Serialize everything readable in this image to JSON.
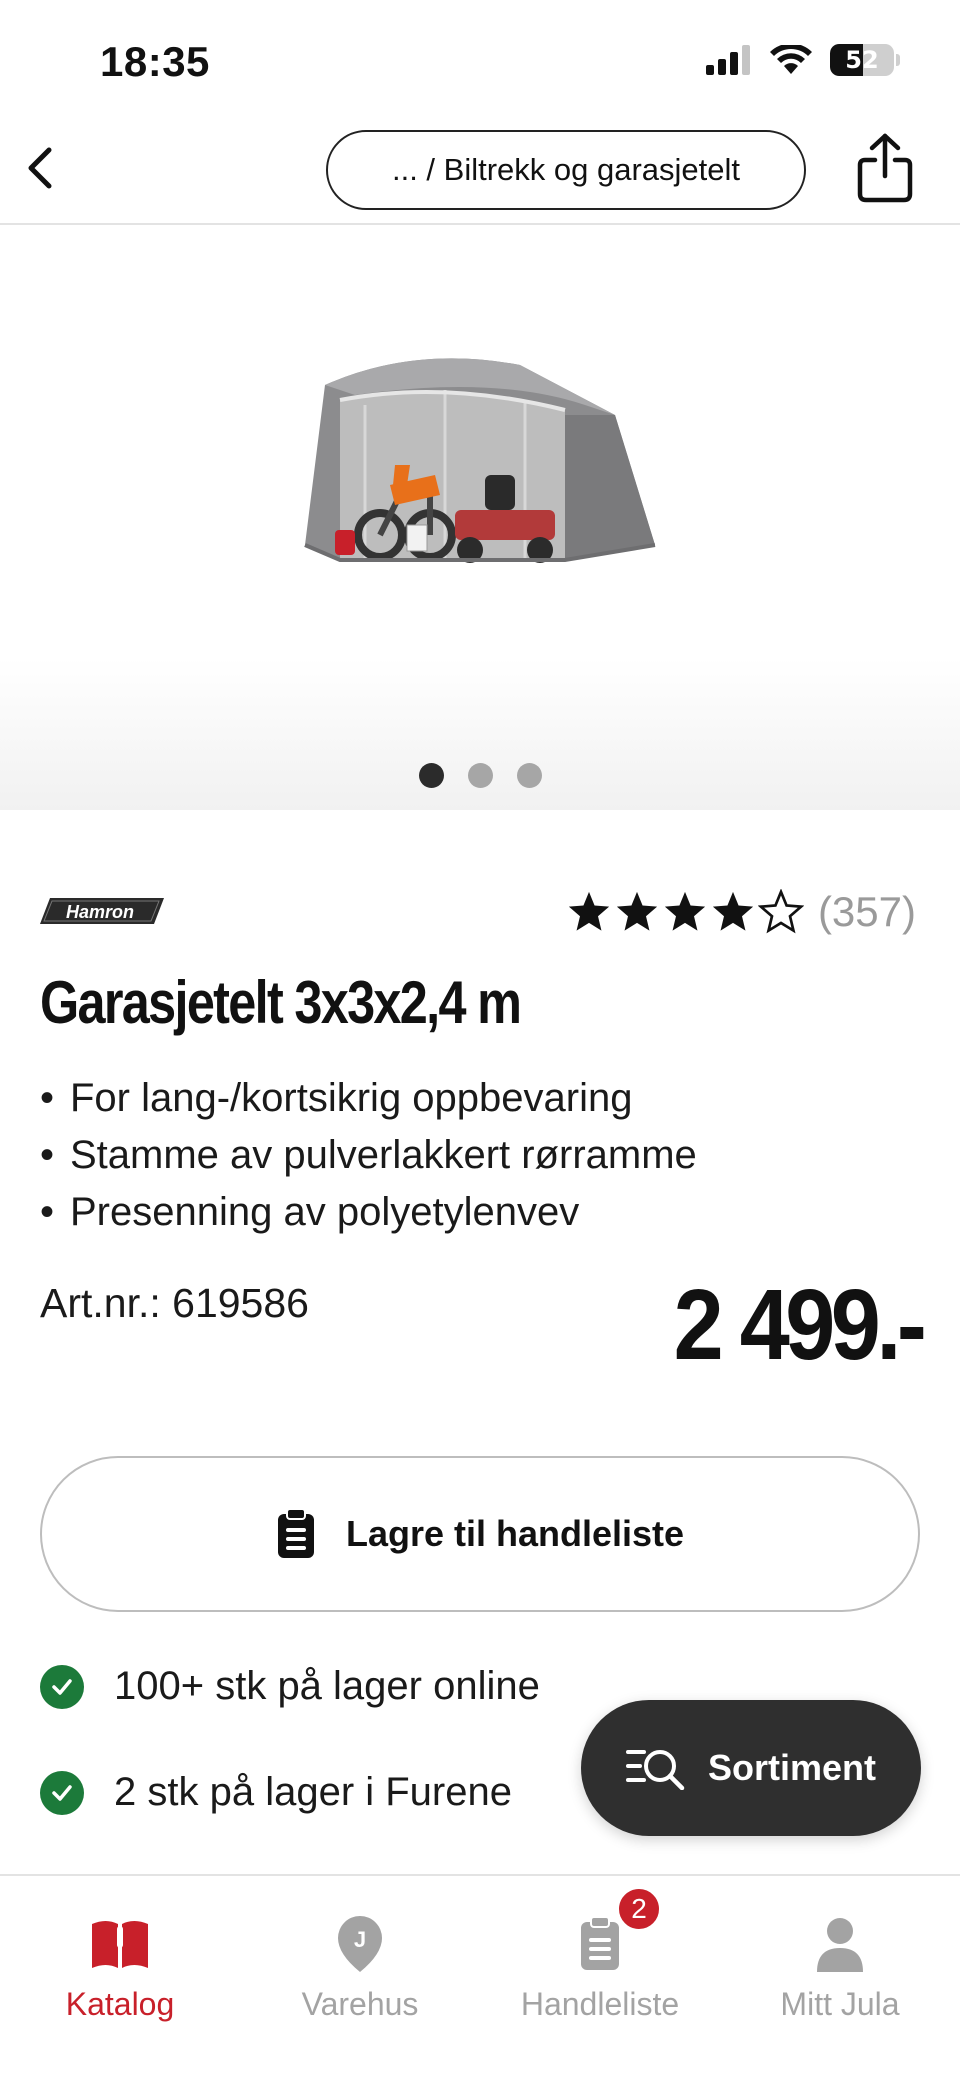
{
  "status_bar": {
    "time": "18:35",
    "battery": "52",
    "battery_level": 0.52
  },
  "nav": {
    "breadcrumb": "... / Biltrekk og garasjetelt",
    "back_icon": "chevron-left-icon",
    "share_icon": "share-icon"
  },
  "gallery": {
    "image_count": 3,
    "active_index": 0
  },
  "product": {
    "brand": "Hamron",
    "rating": 4,
    "rating_max": 5,
    "review_count": "(357)",
    "title": "Garasjetelt 3x3x2,4 m",
    "features": [
      "For lang-/kortsikrig oppbevaring",
      "Stamme av pulverlakkert rørramme",
      "Presenning av polyetylenvev"
    ],
    "art_nr": "Art.nr.: 619586",
    "price": "2 499.-"
  },
  "actions": {
    "save_label": "Lagre til handleliste",
    "sortiment_label": "Sortiment"
  },
  "stock": [
    {
      "text": "100+ stk på lager online"
    },
    {
      "text": "2 stk på lager i Furene"
    }
  ],
  "tabs": [
    {
      "label": "Katalog",
      "icon": "book-icon",
      "active": true
    },
    {
      "label": "Varehus",
      "icon": "location-pin-icon",
      "active": false
    },
    {
      "label": "Handleliste",
      "icon": "clipboard-icon",
      "active": false,
      "badge": "2"
    },
    {
      "label": "Mitt Jula",
      "icon": "person-icon",
      "active": false
    }
  ],
  "colors": {
    "accent_red": "#c8202a",
    "check_green": "#1c7a3a",
    "dark_button": "#2f2f2f"
  }
}
